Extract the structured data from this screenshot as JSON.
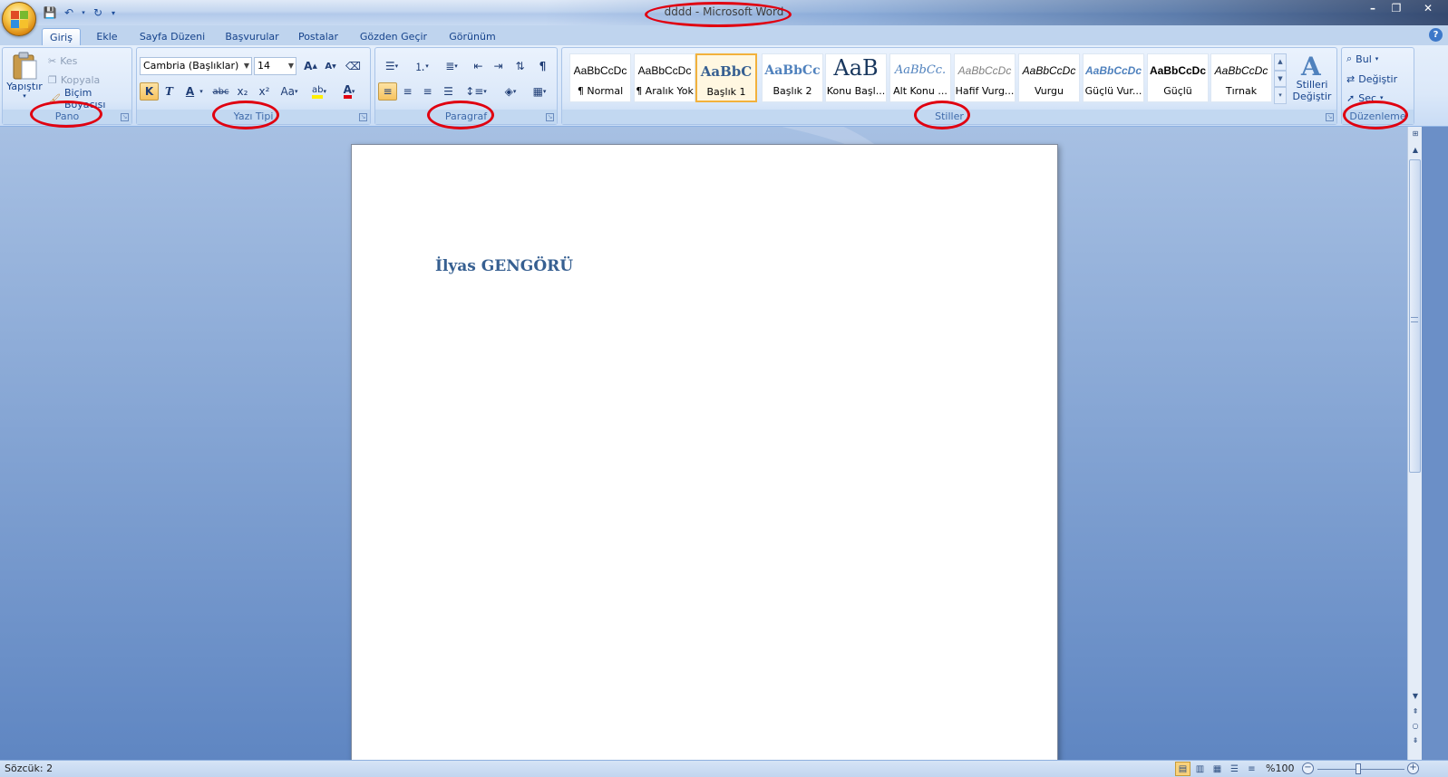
{
  "window": {
    "title": "dddd - Microsoft Word"
  },
  "tabs": [
    {
      "label": "Giriş",
      "active": true
    },
    {
      "label": "Ekle"
    },
    {
      "label": "Sayfa Düzeni"
    },
    {
      "label": "Başvurular"
    },
    {
      "label": "Postalar"
    },
    {
      "label": "Gözden Geçir"
    },
    {
      "label": "Görünüm"
    }
  ],
  "groups": {
    "pano": {
      "label": "Pano",
      "paste": "Yapıştır",
      "cut": "Kes",
      "copy": "Kopyala",
      "format_painter": "Biçim Boyacısı"
    },
    "font": {
      "label": "Yazı Tipi",
      "font_name": "Cambria (Başlıklar)",
      "font_size": "14",
      "grow": "A",
      "shrink": "A",
      "bold": "K",
      "italic": "T",
      "underline": "A",
      "strike": "abc",
      "subscript": "x₂",
      "superscript": "x²",
      "case": "Aa",
      "highlight": "ab",
      "font_color": "A"
    },
    "paragraph": {
      "label": "Paragraf"
    },
    "styles": {
      "label": "Stiller",
      "items": [
        {
          "sample": "AaBbCcDc",
          "name": "¶ Normal"
        },
        {
          "sample": "AaBbCcDc",
          "name": "¶ Aralık Yok"
        },
        {
          "sample": "AaBbC",
          "name": "Başlık 1",
          "selected": true
        },
        {
          "sample": "AaBbCc",
          "name": "Başlık 2"
        },
        {
          "sample": "AaB",
          "name": "Konu Başl..."
        },
        {
          "sample": "AaBbCc.",
          "name": "Alt Konu ..."
        },
        {
          "sample": "AaBbCcDc",
          "name": "Hafif Vurg..."
        },
        {
          "sample": "AaBbCcDc",
          "name": "Vurgu"
        },
        {
          "sample": "AaBbCcDc",
          "name": "Güçlü Vur..."
        },
        {
          "sample": "AaBbCcDc",
          "name": "Güçlü"
        },
        {
          "sample": "AaBbCcDc",
          "name": "Tırnak"
        }
      ],
      "change_styles_line1": "Stilleri",
      "change_styles_line2": "Değiştir"
    },
    "editing": {
      "label": "Düzenleme",
      "find": "Bul",
      "replace": "Değiştir",
      "select": "Seç"
    }
  },
  "document": {
    "heading": "İlyas GENGÖRÜ"
  },
  "status": {
    "word_count": "Sözcük: 2",
    "zoom": "%100",
    "zoom_level_percent": 100
  },
  "colors": {
    "annotation": "#e00010",
    "heading": "#365f91",
    "ribbon_text": "#15428b"
  }
}
